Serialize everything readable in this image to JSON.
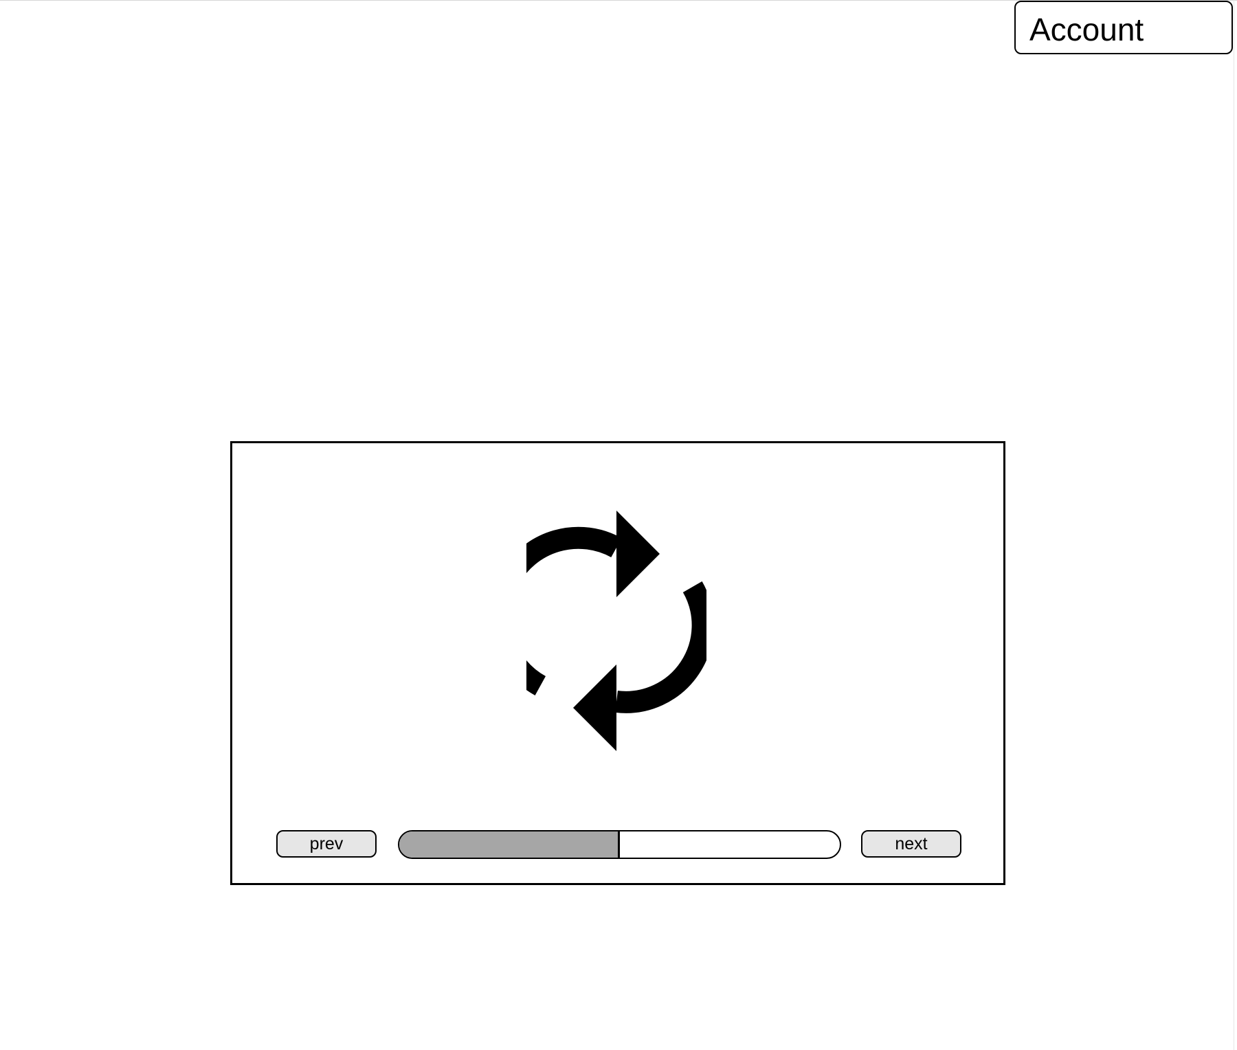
{
  "header": {
    "account_label": "Account"
  },
  "slideshow": {
    "icon": "refresh-icon",
    "prev_label": "prev",
    "next_label": "next",
    "progress_fraction": 0.5
  },
  "colors": {
    "progress_fill": "#a6a6a6",
    "button_background": "#e6e6e6",
    "border": "#000000"
  }
}
